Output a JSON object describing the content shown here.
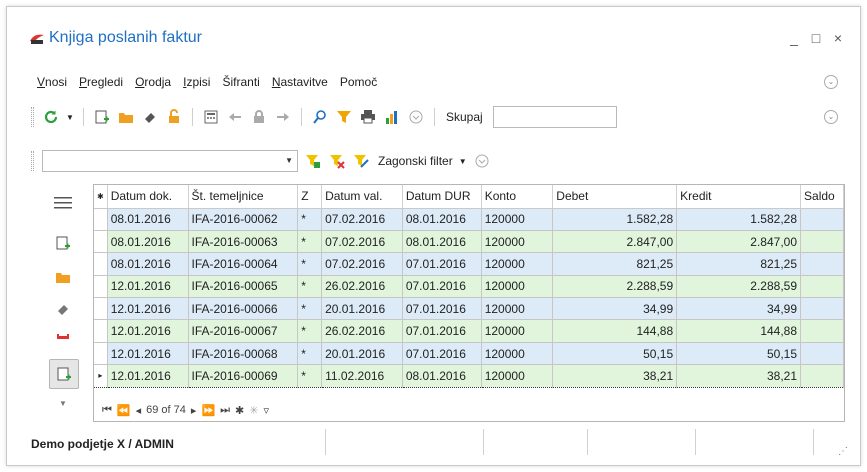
{
  "window": {
    "title": "Knjiga poslanih faktur",
    "minimize_glyph": "_",
    "maximize_glyph": "□",
    "close_glyph": "×"
  },
  "menu": {
    "items": [
      {
        "first": "V",
        "rest": "nosi"
      },
      {
        "first": "P",
        "rest": "regledi"
      },
      {
        "first": "O",
        "rest": "rodja"
      },
      {
        "first": "I",
        "rest": "zpisi"
      },
      {
        "first": "",
        "rest": "Šifranti"
      },
      {
        "first": "N",
        "rest": "astavitve"
      },
      {
        "first": "",
        "rest": "Pomoč"
      }
    ]
  },
  "toolbar": {
    "search_label": "Skupaj",
    "search_value": ""
  },
  "filterbar": {
    "combo_value": "",
    "filter_label": "Zagonski filter"
  },
  "grid": {
    "columns": [
      "Datum dok.",
      "Št. temeljnice",
      "Z",
      "Datum val.",
      "Datum DUR",
      "Konto",
      "Debet",
      "Kredit",
      "Saldo"
    ],
    "rows": [
      {
        "datum_dok": "08.01.2016",
        "temeljnica": "IFA-2016-00062",
        "z": "*",
        "datum_val": "07.02.2016",
        "datum_dur": "08.01.2016",
        "konto": "120000",
        "debet": "1.582,28",
        "kredit": "1.582,28",
        "saldo": ""
      },
      {
        "datum_dok": "08.01.2016",
        "temeljnica": "IFA-2016-00063",
        "z": "*",
        "datum_val": "07.02.2016",
        "datum_dur": "08.01.2016",
        "konto": "120000",
        "debet": "2.847,00",
        "kredit": "2.847,00",
        "saldo": ""
      },
      {
        "datum_dok": "08.01.2016",
        "temeljnica": "IFA-2016-00064",
        "z": "*",
        "datum_val": "07.02.2016",
        "datum_dur": "07.01.2016",
        "konto": "120000",
        "debet": "821,25",
        "kredit": "821,25",
        "saldo": ""
      },
      {
        "datum_dok": "12.01.2016",
        "temeljnica": "IFA-2016-00065",
        "z": "*",
        "datum_val": "26.02.2016",
        "datum_dur": "07.01.2016",
        "konto": "120000",
        "debet": "2.288,59",
        "kredit": "2.288,59",
        "saldo": ""
      },
      {
        "datum_dok": "12.01.2016",
        "temeljnica": "IFA-2016-00066",
        "z": "*",
        "datum_val": "20.01.2016",
        "datum_dur": "07.01.2016",
        "konto": "120000",
        "debet": "34,99",
        "kredit": "34,99",
        "saldo": ""
      },
      {
        "datum_dok": "12.01.2016",
        "temeljnica": "IFA-2016-00067",
        "z": "*",
        "datum_val": "26.02.2016",
        "datum_dur": "07.01.2016",
        "konto": "120000",
        "debet": "144,88",
        "kredit": "144,88",
        "saldo": ""
      },
      {
        "datum_dok": "12.01.2016",
        "temeljnica": "IFA-2016-00068",
        "z": "*",
        "datum_val": "20.01.2016",
        "datum_dur": "07.01.2016",
        "konto": "120000",
        "debet": "50,15",
        "kredit": "50,15",
        "saldo": ""
      },
      {
        "datum_dok": "12.01.2016",
        "temeljnica": "IFA-2016-00069",
        "z": "*",
        "datum_val": "11.02.2016",
        "datum_dur": "08.01.2016",
        "konto": "120000",
        "debet": "38,21",
        "kredit": "38,21",
        "saldo": ""
      }
    ],
    "current_row_index": 7,
    "navigator_text": "69 of 74"
  },
  "status": {
    "text": "Demo podjetje X / ADMIN"
  },
  "colors": {
    "title": "#1f6fc4",
    "row_blue": "#dcebf7",
    "row_green": "#e1f5dd",
    "refresh_green": "#2e9e3a",
    "folder_orange": "#f0a020",
    "filter_yellow": "#f2c200"
  }
}
